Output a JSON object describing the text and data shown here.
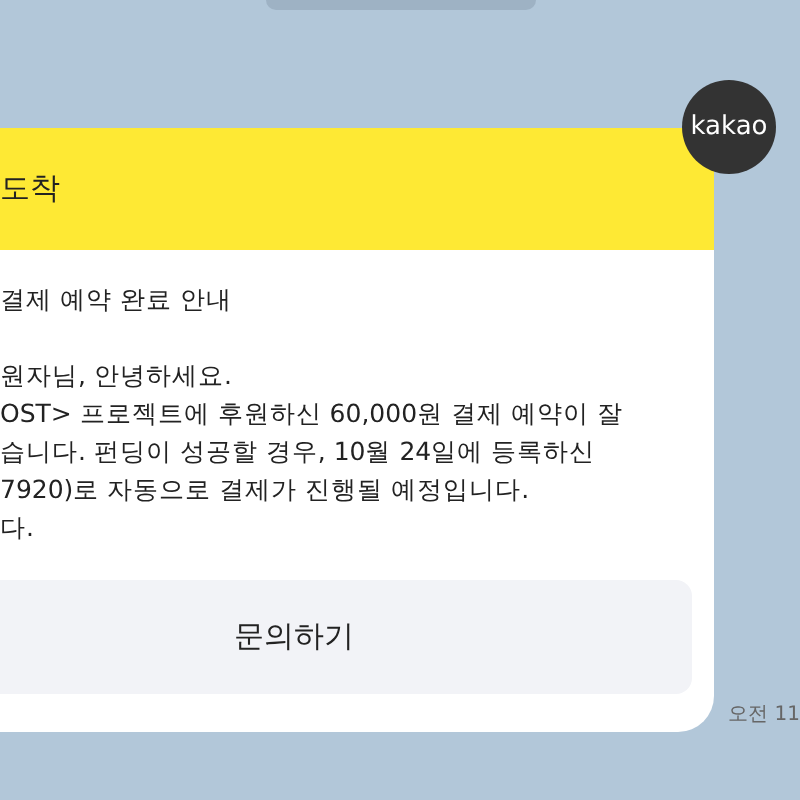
{
  "message": {
    "header_title": "도착",
    "subject": "결제 예약 완료 안내",
    "body_lines": [
      "원자님, 안녕하세요.",
      "OST> 프로젝트에 후원하신 60,000원 결제 예약이 잘",
      "습니다. 펀딩이 성공할 경우, 10월 24일에 등록하신",
      "7920)로 자동으로 결제가 진행될 예정입니다.",
      "다."
    ],
    "button": "문의하기",
    "time": "오전 11"
  },
  "sender": {
    "avatar_text": "kakao"
  }
}
